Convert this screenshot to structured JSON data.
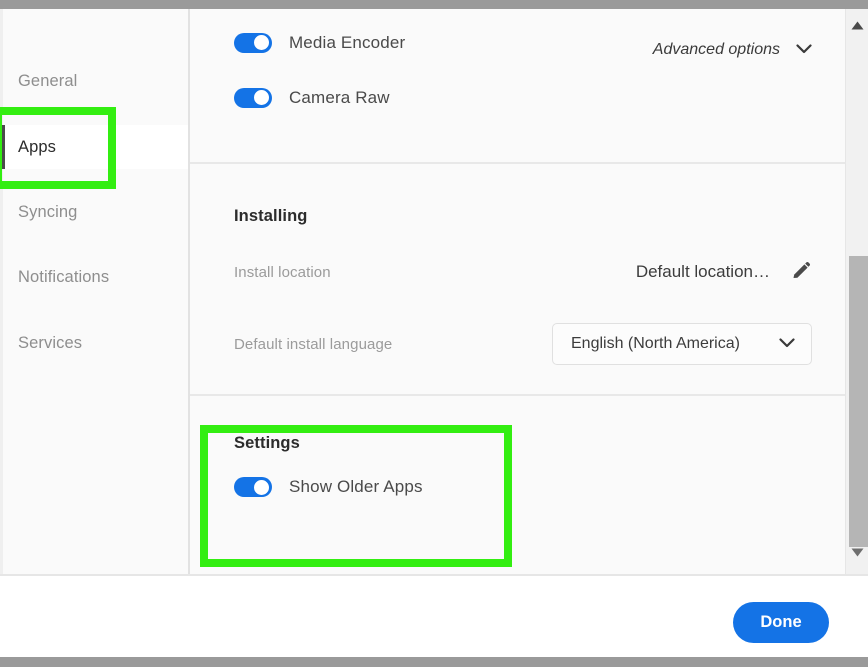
{
  "sidebar": {
    "items": [
      {
        "label": "General",
        "active": false
      },
      {
        "label": "Apps",
        "active": true
      },
      {
        "label": "Syncing",
        "active": false
      },
      {
        "label": "Notifications",
        "active": false
      },
      {
        "label": "Services",
        "active": false
      }
    ]
  },
  "main": {
    "apps_section": {
      "advanced_options_label": "Advanced options",
      "advanced_options_icon": "chevron-down-icon",
      "toggles": [
        {
          "label": "Media Encoder",
          "on": true
        },
        {
          "label": "Camera Raw",
          "on": true
        }
      ]
    },
    "installing_section": {
      "title": "Installing",
      "install_location": {
        "label": "Install location",
        "value": "Default location…",
        "edit_icon": "pencil-icon"
      },
      "default_language": {
        "label": "Default install language",
        "value": "English (North America)",
        "icon": "chevron-down-icon"
      }
    },
    "settings_section": {
      "title": "Settings",
      "toggles": [
        {
          "label": "Show Older Apps",
          "on": true
        }
      ]
    }
  },
  "scrollbar": {
    "up_icon": "caret-up-icon",
    "down_icon": "caret-down-icon"
  },
  "footer": {
    "done_label": "Done"
  },
  "annotations": [
    {
      "name": "apps-highlight",
      "color": "#33EE11"
    },
    {
      "name": "settings-highlight",
      "color": "#33EE11"
    }
  ],
  "colors": {
    "accent_blue": "#1473E6",
    "highlight_green": "#33EE11",
    "chrome_gray": "#9A9A9A",
    "panel_bg": "#FAFAFA"
  }
}
